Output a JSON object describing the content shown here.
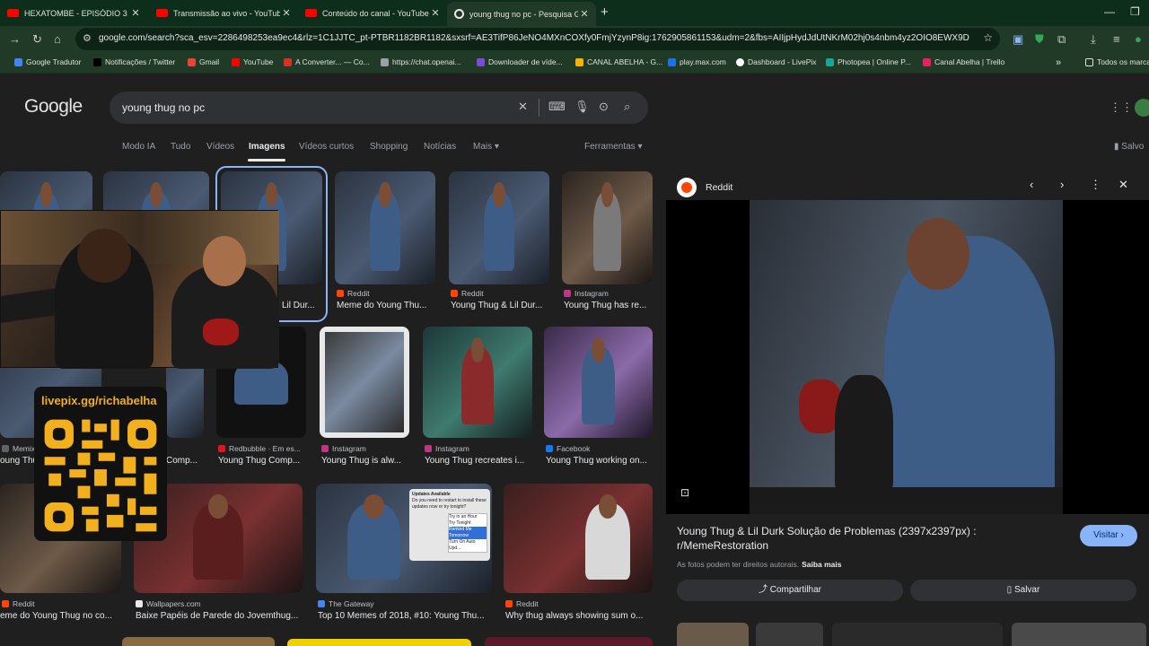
{
  "tabs": [
    {
      "title": "HEXATOMBE - EPISÓDIO 3 - \"U..."
    },
    {
      "title": "Transmissão ao vivo - YouTube S..."
    },
    {
      "title": "Conteúdo do canal - YouTube St..."
    },
    {
      "title": "young thug no pc - Pesquisa G..."
    }
  ],
  "address": {
    "url": "google.com/search?sca_esv=2286498253ea9ec4&rlz=1C1JJTC_pt-PTBR1182BR1182&sxsrf=AE3TifP86JeNO4MXnCOXfy0FmjYzynP8ig:1762905861153&udm=2&fbs=AIIjpHydJdUtNKrM02hj0s4nbm4yz2OIO8EWX9DX1JDOVfAN..."
  },
  "bookmarks": [
    {
      "label": "Google Tradutor",
      "color": "#4285f4"
    },
    {
      "label": "Notificações / Twitter",
      "color": "#000000"
    },
    {
      "label": "Gmail",
      "color": "#ea4335"
    },
    {
      "label": "YouTube",
      "color": "#ff0000"
    },
    {
      "label": "A Converter... — Co...",
      "color": "#d93025"
    },
    {
      "label": "https://chat.openai...",
      "color": "#9aa0a6"
    },
    {
      "label": "Downloader de víde...",
      "color": "#7b4bd6"
    },
    {
      "label": "CANAL ABELHA - G...",
      "color": "#f4b400"
    },
    {
      "label": "play.max.com",
      "color": "#1a73e8"
    },
    {
      "label": "Dashboard - LivePix",
      "color": "#ffffff"
    },
    {
      "label": "Photopea | Online P...",
      "color": "#18a497"
    },
    {
      "label": "Canal Abelha | Trello",
      "color": "#e91e63"
    },
    {
      "label": "Todos os marca...",
      "color": "#9aa0a6"
    }
  ],
  "google": {
    "logo": "Google",
    "query": "young thug no pc",
    "tabs": [
      "Modo IA",
      "Tudo",
      "Vídeos",
      "Imagens",
      "Vídeos curtos",
      "Shopping",
      "Notícias",
      "Mais ▾",
      "Ferramentas ▾"
    ],
    "saved": "Salvo"
  },
  "results": [
    {
      "source": "Reddit",
      "title": "Lil Dur...",
      "color": "#ff4500"
    },
    {
      "source": "Reddit",
      "title": "Meme do Young Thu...",
      "color": "#ff4500"
    },
    {
      "source": "Reddit",
      "title": "Young Thug & Lil Dur...",
      "color": "#ff4500"
    },
    {
      "source": "Instagram",
      "title": "Young Thug has re...",
      "color": "#c13584"
    },
    {
      "source": "Memix",
      "title": "oung Thug ...",
      "color": "#5f6368"
    },
    {
      "source": "",
      "title": "Comp...",
      "color": "#5f6368"
    },
    {
      "source": "Redbubble · Em es...",
      "title": "Young Thug Comp...",
      "color": "#e41321"
    },
    {
      "source": "Instagram",
      "title": "Young Thug is alw...",
      "color": "#c13584"
    },
    {
      "source": "Instagram",
      "title": "Young Thug recreates i...",
      "color": "#c13584"
    },
    {
      "source": "Facebook",
      "title": "Young Thug working on...",
      "color": "#1877f2"
    },
    {
      "source": "Reddit",
      "title": "eme do Young Thug no co...",
      "color": "#ff4500"
    },
    {
      "source": "Wallpapers.com",
      "title": "Baixe Papéis de Parede do Jovemthug...",
      "color": "#e8eaed"
    },
    {
      "source": "The Gateway",
      "title": "Top 10 Memes of 2018, #10: Young Thu...",
      "color": "#4285f4"
    },
    {
      "source": "Reddit",
      "title": "Why thug always showing sum o...",
      "color": "#ff4500"
    }
  ],
  "overlay": {
    "livepix": "livepix.gg/richabelha"
  },
  "panel": {
    "source": "Reddit",
    "title": "Young Thug & Lil Durk Solução de Problemas (2397x2397px) : r/MemeRestoration",
    "visit": "Visitar ›",
    "rights": "As fotos podem ter direitos autorais.",
    "learn": "Saiba mais",
    "share": "Compartilhar",
    "save": "Salvar"
  },
  "notification_text": {
    "title": "Updates Available",
    "body": "Do you need to restart to install these updates now or try tonight?",
    "opts": [
      "Try in an Hour",
      "Try Tonight",
      "Remind Me Tomorrow",
      "Turn On Auto Upd..."
    ]
  }
}
